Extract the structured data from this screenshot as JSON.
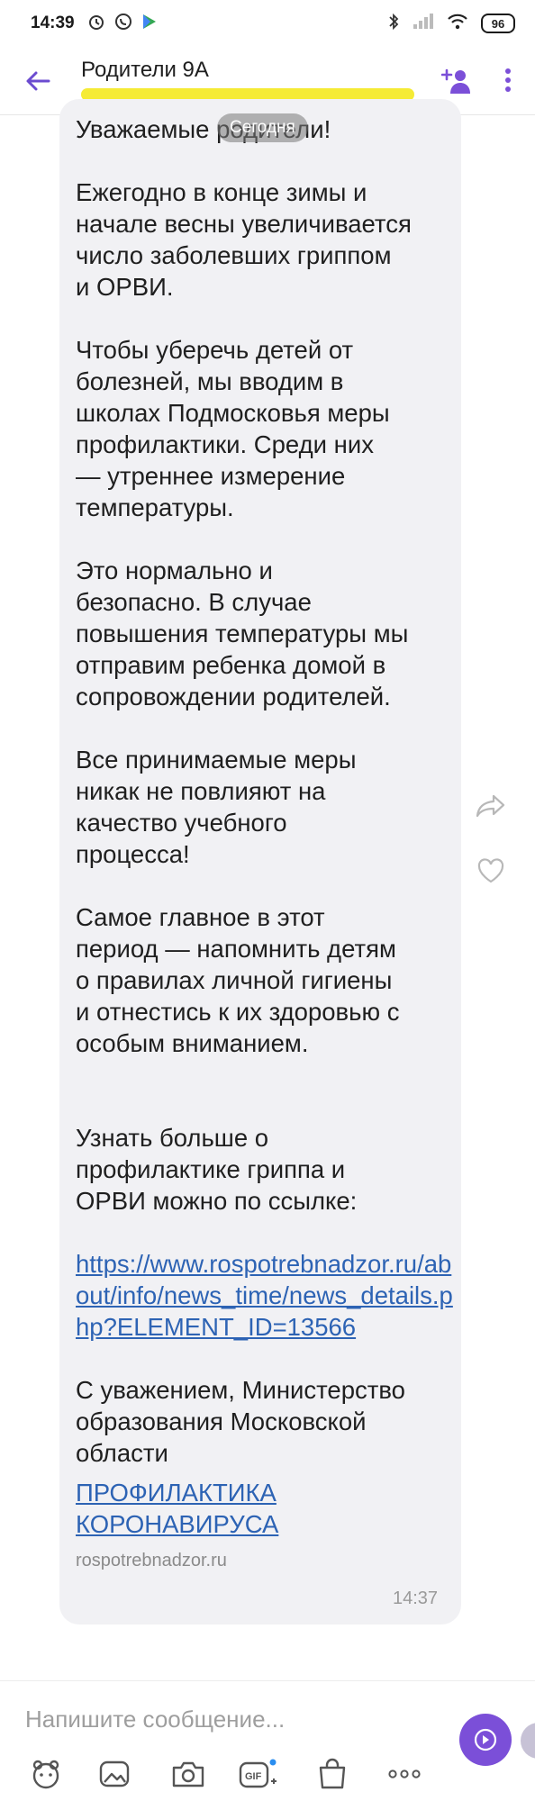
{
  "status_bar": {
    "time": "14:39",
    "battery": "96"
  },
  "header": {
    "title": "Родители 9А"
  },
  "date_pill": "Сегодня",
  "message": {
    "paragraphs": [
      "Уважаемые родители!",
      "Ежегодно в конце зимы и\nначале весны увеличивается\nчисло заболевших гриппом\nи ОРВИ.",
      "Чтобы уберечь детей от\nболезней, мы вводим в\nшколах Подмосковья меры\nпрофилактики. Среди них\n— утреннее измерение\nтемпературы.",
      "Это нормально и\nбезопасно. В случае\nповышения температуры мы\nотправим ребенка домой в\nсопровождении родителей.",
      "Все принимаемые меры\nникак не повлияют на\nкачество учебного\nпроцесса!",
      "Самое главное в этот\nпериод — напомнить детям\nо правилах личной гигиены\nи отнестись к их здоровью с\nособым вниманием.",
      "Узнать больше о\nпрофилактике гриппа и\nОРВИ можно по ссылке:"
    ],
    "url": "https://www.rospotrebnadzor.ru/about/info/news_time/news_details.php?ELEMENT_ID=13566",
    "signature": "С уважением, Министерство\nобразования Московской\nобласти",
    "preview_title": "ПРОФИЛАКТИКА\nКОРОНАВИРУСА",
    "preview_domain": "rospotrebnadzor.ru",
    "time": "14:37"
  },
  "composer": {
    "placeholder": "Напишите сообщение..."
  },
  "colors": {
    "accent": "#7b4fd8",
    "link": "#2d63b4",
    "bubble": "#f1f1f4",
    "highlight": "#f4ea2a"
  },
  "icons": {
    "status_left": [
      "whatsapp-icon",
      "alarm-icon",
      "play-store-icon"
    ],
    "status_right": [
      "bluetooth-icon",
      "signal-icon",
      "wifi-icon",
      "battery-icon"
    ],
    "header": [
      "back-arrow-icon",
      "add-member-icon",
      "more-vertical-icon"
    ],
    "message_actions": [
      "forward-icon",
      "heart-icon"
    ],
    "toolbar": [
      "sticker-icon",
      "gallery-icon",
      "camera-icon",
      "gif-icon",
      "shopping-bag-icon",
      "more-horizontal-icon",
      "voice-message-icon"
    ]
  }
}
